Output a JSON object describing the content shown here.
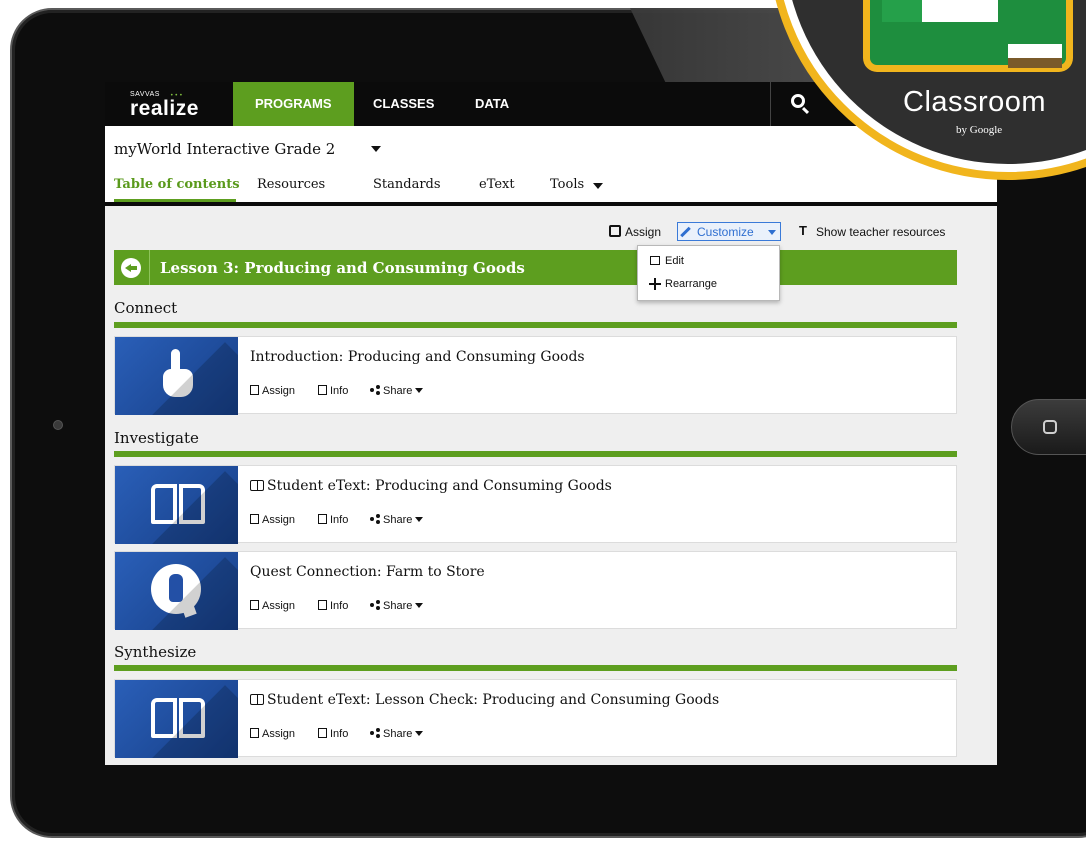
{
  "brand": {
    "small": "SAVVAS",
    "name": "realize"
  },
  "topnav": {
    "programs": "PROGRAMS",
    "classes": "CLASSES",
    "data": "DATA"
  },
  "program": {
    "title": "myWorld Interactive Grade 2"
  },
  "subtabs": {
    "toc": "Table of contents",
    "resources": "Resources",
    "standards": "Standards",
    "etext": "eText",
    "tools": "Tools"
  },
  "toolbar": {
    "assign": "Assign",
    "customize": "Customize",
    "show_teacher": "Show teacher resources"
  },
  "dropdown": {
    "edit": "Edit",
    "rearrange": "Rearrange"
  },
  "lesson": {
    "title": "Lesson 3: Producing and Consuming Goods"
  },
  "sections": {
    "connect": "Connect",
    "investigate": "Investigate",
    "synthesize": "Synthesize"
  },
  "cards": [
    {
      "title": "Introduction: Producing and Consuming Goods",
      "icon": "hand-pointer-icon"
    },
    {
      "title": "Student eText: Producing and Consuming Goods",
      "icon": "open-book-icon"
    },
    {
      "title": "Quest Connection: Farm to Store",
      "icon": "quest-icon"
    },
    {
      "title": "Student eText: Lesson Check: Producing and Consuming Goods",
      "icon": "open-book-icon"
    }
  ],
  "actions": {
    "assign": "Assign",
    "info": "Info",
    "share": "Share"
  },
  "classroom": {
    "name": "Classroom",
    "by": "by Google"
  },
  "colors": {
    "accent_green": "#5d9e1f",
    "link_blue": "#2f6fd0",
    "badge_gold": "#f1b51d",
    "thumb_blue": "#2a5fb8"
  }
}
